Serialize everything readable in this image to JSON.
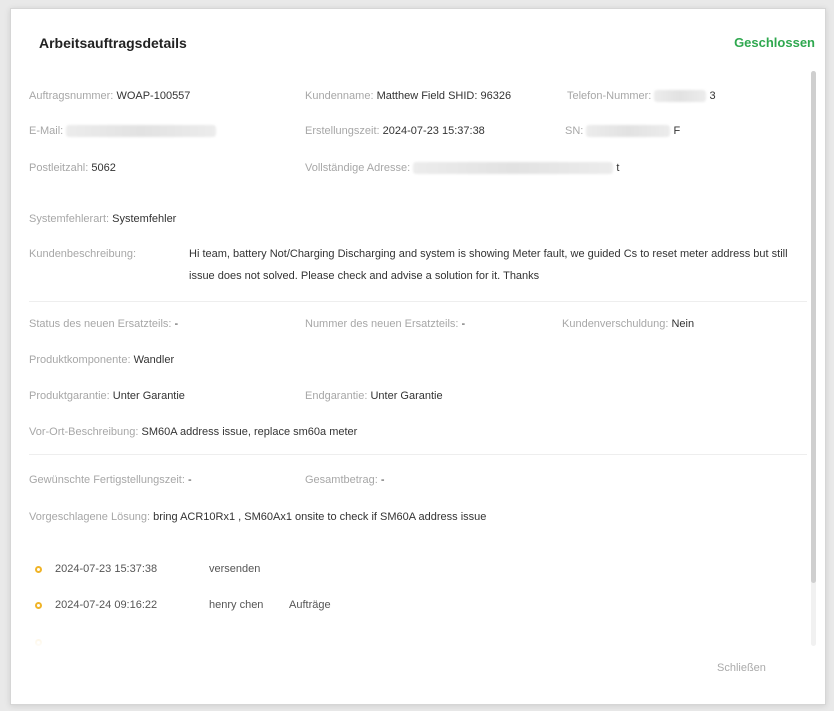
{
  "dialog": {
    "title": "Arbeitsauftragsdetails",
    "status": "Geschlossen",
    "status_color": "#2fa84f",
    "close_label": "Schließen"
  },
  "fields": {
    "order_number_label": "Auftragsnummer:",
    "order_number": "WOAP-100557",
    "customer_name_label": "Kundenname:",
    "customer_name": "Matthew Field SHID: 96326",
    "phone_label": "Telefon-Nummer:",
    "phone_suffix": "3",
    "email_label": "E-Mail:",
    "created_label": "Erstellungszeit:",
    "created": "2024-07-23 15:37:38",
    "sn_label": "SN:",
    "sn_suffix": "F",
    "postcode_label": "Postleitzahl:",
    "postcode": "5062",
    "address_label": "Vollständige Adresse:",
    "address_suffix": "t",
    "fault_type_label": "Systemfehlerart:",
    "fault_type": "Systemfehler",
    "customer_desc_label": "Kundenbeschreibung:",
    "customer_desc": "Hi team, battery Not/Charging Discharging and system is showing Meter fault, we guided Cs to reset meter address but still issue does not solved. Please check and advise a solution for it. Thanks",
    "new_part_status_label": "Status des neuen Ersatzteils:",
    "new_part_status": "-",
    "new_part_number_label": "Nummer des neuen Ersatzteils:",
    "new_part_number": "-",
    "customer_fault_label": "Kundenverschuldung:",
    "customer_fault": "Nein",
    "component_label": "Produktkomponente:",
    "component": "Wandler",
    "product_warranty_label": "Produktgarantie:",
    "product_warranty": "Unter Garantie",
    "final_warranty_label": "Endgarantie:",
    "final_warranty": "Unter Garantie",
    "onsite_desc_label": "Vor-Ort-Beschreibung:",
    "onsite_desc": "SM60A address issue, replace sm60a meter",
    "desired_completion_label": "Gewünschte Fertigstellungszeit:",
    "desired_completion": "-",
    "total_amount_label": "Gesamtbetrag:",
    "total_amount": "-",
    "suggested_solution_label": "Vorgeschlagene Lösung:",
    "suggested_solution": "bring ACR10Rx1 , SM60Ax1 onsite to check if SM60A address issue"
  },
  "timeline": [
    {
      "date": "2024-07-23 15:37:38",
      "user": "",
      "action": "versenden"
    },
    {
      "date": "2024-07-24 09:16:22",
      "user": "henry chen",
      "action": "Aufträge"
    }
  ],
  "colors": {
    "timeline_dot": "#f0b428",
    "label": "#a7a7a7"
  }
}
